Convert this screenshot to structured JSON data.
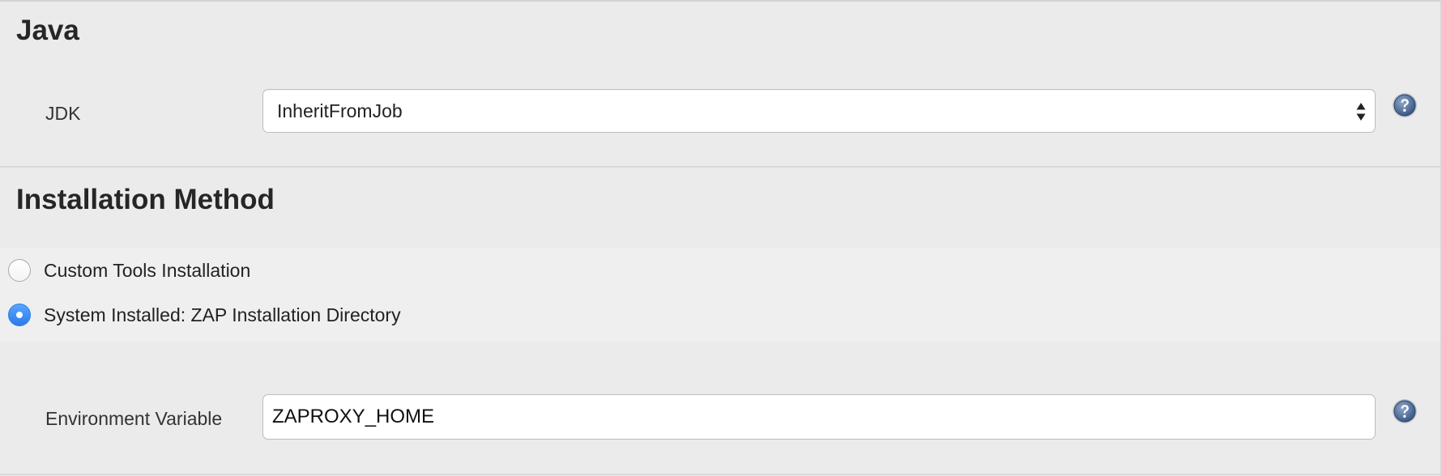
{
  "java_section": {
    "title": "Java",
    "jdk_label": "JDK",
    "jdk_selected": "InheritFromJob"
  },
  "installation_section": {
    "title": "Installation Method",
    "options": [
      {
        "label": "Custom Tools Installation",
        "checked": false
      },
      {
        "label": "System Installed: ZAP Installation Directory",
        "checked": true
      }
    ],
    "env_var_label": "Environment Variable",
    "env_var_value": "ZAPROXY_HOME"
  },
  "icons": {
    "help": "help-icon",
    "select_arrows": "up-down-arrows-icon"
  },
  "colors": {
    "background": "#ebebeb",
    "radio_checked": "#2b7bea",
    "help_icon": "#3f5f8c"
  }
}
